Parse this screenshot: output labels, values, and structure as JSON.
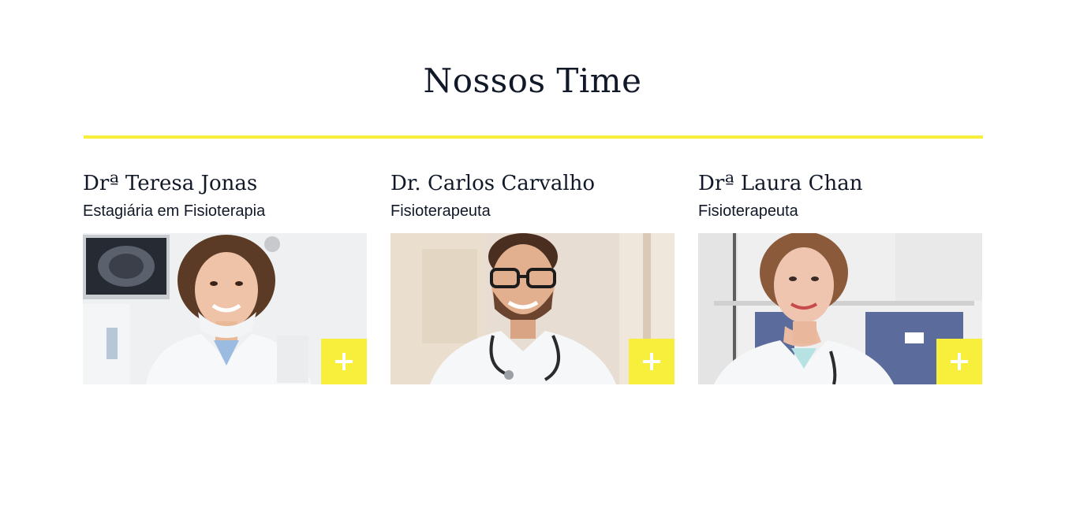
{
  "section": {
    "title": "Nossos Time"
  },
  "colors": {
    "accent": "#f7ef3c",
    "text": "#111827",
    "background": "#ffffff"
  },
  "team": [
    {
      "name": "Drª Teresa Jonas",
      "role": "Estagiária em Fisioterapia",
      "photo_icon": "doctor-photo",
      "action_icon": "plus-icon"
    },
    {
      "name": "Dr. Carlos Carvalho",
      "role": "Fisioterapeuta",
      "photo_icon": "doctor-photo",
      "action_icon": "plus-icon"
    },
    {
      "name": "Drª Laura Chan",
      "role": "Fisioterapeuta",
      "photo_icon": "doctor-photo",
      "action_icon": "plus-icon"
    }
  ]
}
